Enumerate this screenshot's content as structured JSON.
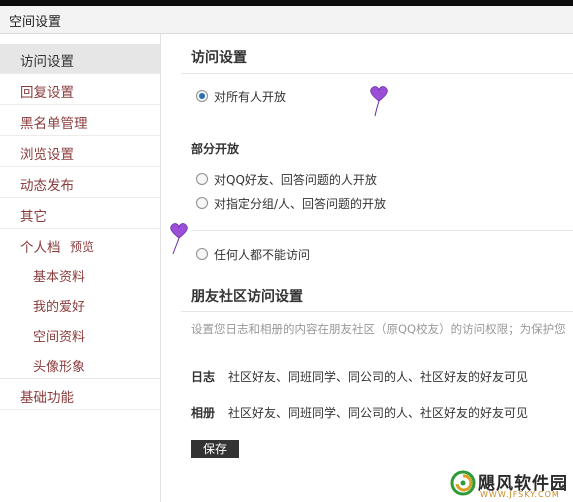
{
  "window": {
    "title": "空间设置"
  },
  "sidebar": {
    "items": [
      {
        "label": "访问设置"
      },
      {
        "label": "回复设置"
      },
      {
        "label": "黑名单管理"
      },
      {
        "label": "浏览设置"
      },
      {
        "label": "动态发布"
      },
      {
        "label": "其它"
      },
      {
        "label": "个人档",
        "extra": "预览"
      },
      {
        "label": "基础功能"
      }
    ],
    "sub_items": [
      "基本资料",
      "我的爱好",
      "空间资料",
      "头像形象"
    ]
  },
  "main": {
    "access": {
      "title": "访问设置",
      "open_all": "对所有人开放",
      "partial_title": "部分开放",
      "partial_qq": "对QQ好友、回答问题的人开放",
      "partial_group": "对指定分组/人、回答问题的开放",
      "no_access": "任何人都不能访问"
    },
    "community": {
      "title": "朋友社区访问设置",
      "description": "设置您日志和相册的内容在朋友社区（原QQ校友）的访问权限；为保护您",
      "rows": [
        {
          "label": "日志",
          "text": "社区好友、同班同学、同公司的人、社区好友的好友可见"
        },
        {
          "label": "相册",
          "text": "社区好友、同班同学、同公司的人、社区好友的好友可见"
        }
      ],
      "save_label": "保存"
    }
  },
  "watermark": {
    "text": "飓风软件园",
    "url": "WWW.JFSKY.COM"
  },
  "colors": {
    "accent": "#2a6fb8",
    "nav_text": "#8a3c3c",
    "heart": "#9b4fd8"
  }
}
